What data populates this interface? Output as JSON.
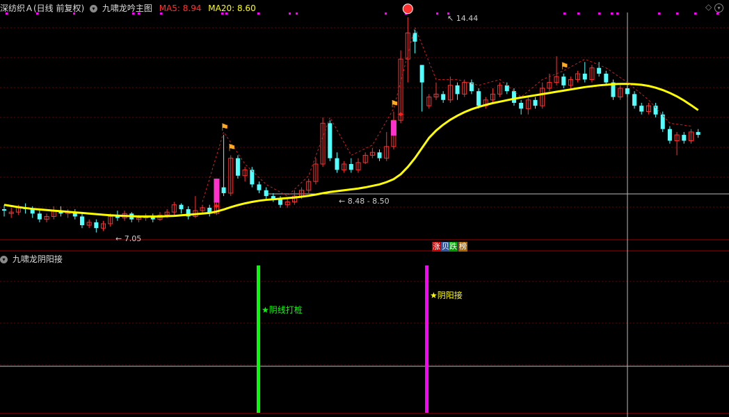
{
  "header": {
    "stock_title": "深纺织Ａ(日线 前复权)",
    "main_indicator": "九啸龙吟主图",
    "ma5_label": "MA5: 8.94",
    "ma20_label": "MA20: 8.60",
    "ma5_color": "#ff3232",
    "ma20_color": "#ffff00"
  },
  "sub_panel": {
    "indicator": "九啸龙阴阳接",
    "signal1_label": "★阴线打桩",
    "signal1_color": "#00ff00",
    "signal2_label": "★阴阳接",
    "signal2_color": "#ff00ff"
  },
  "badges": [
    {
      "text": "涨",
      "color": "#cc0000"
    },
    {
      "text": "贝",
      "color": "#335599"
    },
    {
      "text": "跌",
      "color": "#009900"
    },
    {
      "text": "榜",
      "color": "#aa6600"
    }
  ],
  "chart_data": {
    "type": "candlestick",
    "price_high_label": "14.44",
    "price_low_label": "7.05",
    "range_label": "8.48 - 8.50",
    "up_color": "#ff3232",
    "down_color": "#54ffff",
    "ma_color": "#ffff00",
    "candles": [
      [
        7.85,
        7.8,
        8.0,
        7.6
      ],
      [
        7.7,
        7.75,
        7.9,
        7.55
      ],
      [
        7.75,
        7.9,
        8.0,
        7.65
      ],
      [
        7.9,
        7.85,
        8.05,
        7.7
      ],
      [
        7.85,
        7.7,
        7.95,
        7.55
      ],
      [
        7.7,
        7.5,
        7.8,
        7.4
      ],
      [
        7.5,
        7.6,
        7.7,
        7.4
      ],
      [
        7.6,
        7.8,
        7.95,
        7.5
      ],
      [
        7.8,
        7.7,
        7.95,
        7.6
      ],
      [
        7.7,
        7.75,
        7.85,
        7.55
      ],
      [
        7.75,
        7.6,
        7.85,
        7.5
      ],
      [
        7.6,
        7.3,
        7.7,
        7.2
      ],
      [
        7.3,
        7.4,
        7.5,
        7.2
      ],
      [
        7.4,
        7.2,
        7.5,
        7.05
      ],
      [
        7.2,
        7.35,
        7.45,
        7.1
      ],
      [
        7.35,
        7.6,
        7.7,
        7.25
      ],
      [
        7.6,
        7.55,
        7.8,
        7.45
      ],
      [
        7.55,
        7.7,
        7.8,
        7.45
      ],
      [
        7.7,
        7.5,
        7.75,
        7.4
      ],
      [
        7.5,
        7.55,
        7.65,
        7.4
      ],
      [
        7.55,
        7.6,
        7.7,
        7.45
      ],
      [
        7.6,
        7.5,
        7.7,
        7.4
      ],
      [
        7.5,
        7.65,
        7.75,
        7.45
      ],
      [
        7.65,
        7.75,
        7.85,
        7.55
      ],
      [
        7.75,
        8.0,
        8.1,
        7.65
      ],
      [
        8.0,
        7.85,
        8.05,
        7.7
      ],
      [
        7.85,
        7.6,
        7.95,
        7.5
      ],
      [
        7.6,
        7.8,
        8.3,
        7.55
      ],
      [
        7.8,
        7.9,
        8.0,
        7.7
      ],
      [
        7.9,
        7.7,
        8.0,
        7.6
      ],
      [
        7.7,
        8.6,
        8.7,
        7.65
      ],
      [
        8.6,
        8.4,
        10.4,
        8.3
      ],
      [
        8.4,
        9.6,
        9.7,
        8.3
      ],
      [
        9.6,
        9.0,
        9.7,
        8.9
      ],
      [
        9.0,
        9.2,
        9.3,
        8.8
      ],
      [
        9.2,
        8.7,
        9.3,
        8.6
      ],
      [
        8.7,
        8.5,
        8.8,
        8.4
      ],
      [
        8.5,
        8.3,
        8.6,
        8.2
      ],
      [
        8.3,
        8.2,
        8.4,
        8.1
      ],
      [
        8.2,
        8.0,
        8.3,
        7.9
      ],
      [
        8.0,
        8.1,
        8.2,
        7.9
      ],
      [
        8.1,
        8.3,
        8.5,
        8.0
      ],
      [
        8.3,
        8.5,
        8.6,
        8.2
      ],
      [
        8.5,
        8.8,
        8.9,
        8.4
      ],
      [
        8.8,
        9.4,
        9.6,
        8.7
      ],
      [
        9.4,
        10.8,
        11.0,
        9.3
      ],
      [
        10.8,
        9.6,
        10.9,
        9.5
      ],
      [
        9.6,
        9.2,
        9.8,
        9.1
      ],
      [
        9.2,
        9.4,
        9.5,
        9.1
      ],
      [
        9.4,
        9.2,
        9.6,
        9.1
      ],
      [
        9.2,
        9.45,
        9.6,
        9.1
      ],
      [
        9.45,
        9.7,
        9.8,
        9.4
      ],
      [
        9.7,
        9.8,
        9.95,
        9.6
      ],
      [
        9.8,
        9.6,
        9.9,
        9.5
      ],
      [
        9.6,
        10.0,
        10.5,
        9.5
      ],
      [
        10.0,
        10.9,
        11.2,
        9.9
      ],
      [
        10.9,
        13.0,
        13.3,
        10.8
      ],
      [
        13.0,
        13.9,
        14.44,
        12.2
      ],
      [
        13.9,
        13.6,
        14.0,
        13.2
      ],
      [
        12.8,
        12.2,
        12.4,
        11.2
      ],
      [
        11.4,
        11.7,
        11.8,
        11.3
      ],
      [
        11.7,
        11.8,
        12.2,
        11.6
      ],
      [
        11.8,
        11.6,
        11.9,
        11.5
      ],
      [
        11.6,
        12.1,
        12.4,
        11.5
      ],
      [
        12.1,
        11.8,
        12.2,
        11.6
      ],
      [
        11.8,
        12.2,
        12.3,
        11.7
      ],
      [
        12.2,
        11.9,
        12.3,
        11.8
      ],
      [
        11.9,
        11.4,
        12.0,
        11.3
      ],
      [
        11.4,
        11.6,
        11.7,
        11.3
      ],
      [
        11.6,
        11.8,
        12.0,
        11.5
      ],
      [
        11.8,
        12.1,
        12.2,
        11.7
      ],
      [
        12.1,
        11.9,
        12.2,
        11.8
      ],
      [
        11.9,
        11.5,
        12.0,
        11.4
      ],
      [
        11.5,
        11.3,
        11.6,
        11.1
      ],
      [
        11.3,
        11.6,
        11.7,
        11.1
      ],
      [
        11.6,
        11.4,
        11.7,
        11.3
      ],
      [
        11.4,
        12.0,
        12.2,
        11.3
      ],
      [
        12.0,
        12.2,
        12.5,
        11.9
      ],
      [
        12.2,
        12.4,
        13.1,
        12.1
      ],
      [
        12.4,
        12.1,
        12.5,
        12.0
      ],
      [
        12.1,
        12.3,
        12.4,
        12.0
      ],
      [
        12.3,
        12.5,
        12.6,
        12.2
      ],
      [
        12.5,
        12.3,
        12.9,
        12.2
      ],
      [
        12.3,
        12.7,
        12.8,
        12.2
      ],
      [
        12.7,
        12.5,
        12.9,
        12.4
      ],
      [
        12.5,
        12.2,
        12.6,
        12.1
      ],
      [
        12.2,
        11.7,
        12.3,
        11.6
      ],
      [
        11.7,
        12.0,
        12.1,
        11.6
      ],
      [
        12.0,
        11.8,
        12.1,
        11.7
      ],
      [
        11.8,
        11.4,
        11.9,
        11.3
      ],
      [
        11.4,
        11.2,
        11.5,
        11.1
      ],
      [
        11.2,
        11.4,
        11.5,
        11.1
      ],
      [
        11.4,
        11.1,
        11.5,
        11.0
      ],
      [
        11.1,
        10.6,
        11.2,
        10.5
      ],
      [
        10.6,
        10.2,
        10.7,
        10.1
      ],
      [
        10.2,
        10.4,
        10.5,
        9.7
      ],
      [
        10.4,
        10.2,
        10.5,
        10.1
      ],
      [
        10.2,
        10.5,
        10.6,
        10.1
      ],
      [
        10.5,
        10.4,
        10.6,
        10.3
      ]
    ],
    "ma_curve": [
      8.0,
      7.96,
      7.92,
      7.89,
      7.86,
      7.84,
      7.82,
      7.8,
      7.78,
      7.76,
      7.74,
      7.72,
      7.7,
      7.68,
      7.66,
      7.64,
      7.63,
      7.62,
      7.61,
      7.6,
      7.6,
      7.6,
      7.6,
      7.61,
      7.62,
      7.64,
      7.66,
      7.68,
      7.7,
      7.72,
      7.77,
      7.84,
      7.92,
      7.99,
      8.05,
      8.1,
      8.14,
      8.17,
      8.19,
      8.21,
      8.23,
      8.25,
      8.28,
      8.31,
      8.35,
      8.4,
      8.44,
      8.47,
      8.5,
      8.53,
      8.56,
      8.6,
      8.65,
      8.7,
      8.78,
      8.88,
      9.05,
      9.3,
      9.6,
      9.95,
      10.3,
      10.55,
      10.75,
      10.92,
      11.06,
      11.18,
      11.28,
      11.36,
      11.43,
      11.49,
      11.54,
      11.59,
      11.64,
      11.68,
      11.72,
      11.76,
      11.8,
      11.84,
      11.88,
      11.92,
      11.96,
      12.0,
      12.04,
      12.07,
      12.1,
      12.12,
      12.14,
      12.15,
      12.15,
      12.14,
      12.12,
      12.08,
      12.02,
      11.94,
      11.84,
      11.72,
      11.58,
      11.42,
      11.25
    ],
    "markers": [
      {
        "type": "rocket",
        "i": 30
      },
      {
        "type": "rocket",
        "i": 56
      },
      {
        "type": "ball",
        "i": 57
      },
      {
        "type": "runner",
        "i": 31
      },
      {
        "type": "runner",
        "i": 32
      },
      {
        "type": "runner",
        "i": 55
      },
      {
        "type": "runner",
        "i": 79
      }
    ],
    "signals": [
      {
        "i": 30,
        "series": "阴线打桩"
      },
      {
        "i": 56,
        "series": "阴阳接"
      }
    ]
  }
}
